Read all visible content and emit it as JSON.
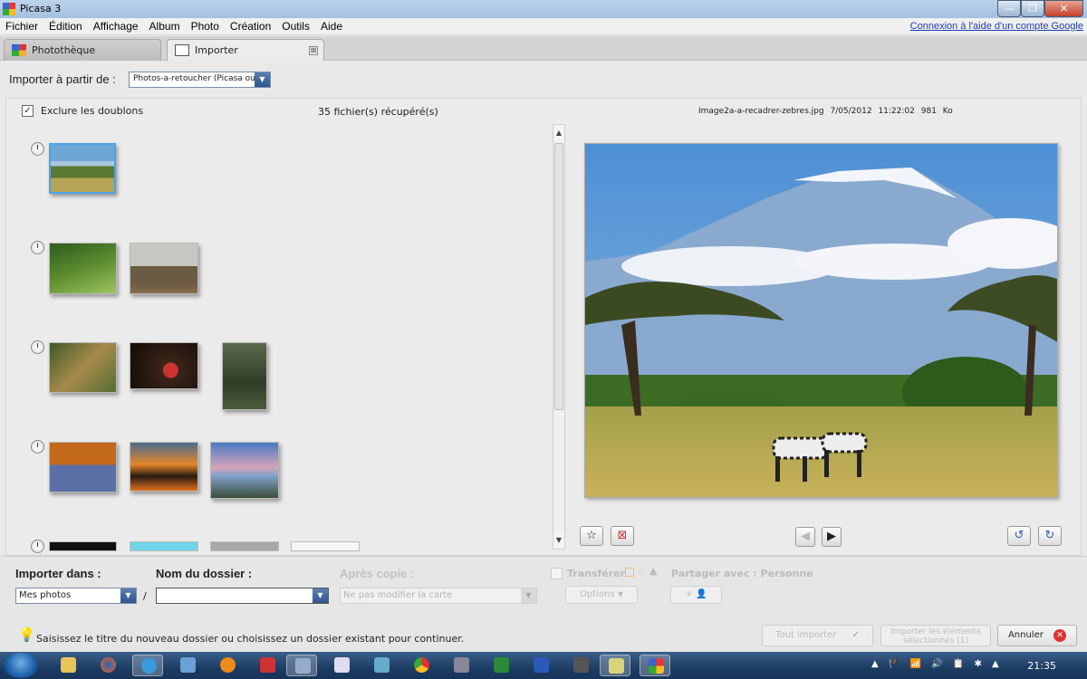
{
  "window": {
    "title": "Picasa 3",
    "controls": [
      "—",
      "❐",
      "✕"
    ]
  },
  "menu": {
    "items": [
      "Fichier",
      "Édition",
      "Affichage",
      "Album",
      "Photo",
      "Création",
      "Outils",
      "Aide"
    ],
    "google_link": "Connexion à l'aide d'un compte Google"
  },
  "tabs": [
    {
      "label": "Photothèque"
    },
    {
      "label": "Importer",
      "close": "⊠"
    }
  ],
  "source": {
    "label": "Importer à partir de :",
    "value": "Photos-a-retoucher (Picasa ou O"
  },
  "panel": {
    "exclude_duplicates": "Exclure les doublons",
    "exclude_checked": true,
    "count": "35 fichier(s) récupéré(s)",
    "selected_file": "Image2a-a-recadrer-zebres.jpg",
    "selected_date": "7/05/2012 11:22:02",
    "selected_size": "981 Ko"
  },
  "icons": {
    "check": "✓",
    "arrow_down": "▼",
    "arrow_up": "▲",
    "star": "☆",
    "reject": "⊠",
    "prev": "◀",
    "next": "▶",
    "rotate_left": "↺",
    "rotate_right": "↻",
    "cancel_x": "✕",
    "bulb": "💡"
  },
  "bottom": {
    "import_into_label": "Importer dans :",
    "import_into_value": "Mes photos",
    "slash": "/",
    "folder_label": "Nom du dossier :",
    "folder_value": "",
    "after_copy_label": "Après copie :",
    "after_copy_value": "Ne pas modifier la carte",
    "transfer_label": "Transférer",
    "share_label": "Partager avec : Personne",
    "options_label": "Options",
    "add_person": "+ 👤"
  },
  "status": {
    "message": "Saisissez le titre du nouveau dossier ou choisissez un dossier existant pour continuer.",
    "import_all": "Tout importer",
    "import_selected": "Importer les éléments sélectionnés (1)",
    "cancel": "Annuler"
  },
  "taskbar": {
    "time": "21:35",
    "tray": [
      "▲",
      "🏴",
      "📶",
      "🔊",
      "📋",
      "✱",
      "▲"
    ]
  }
}
